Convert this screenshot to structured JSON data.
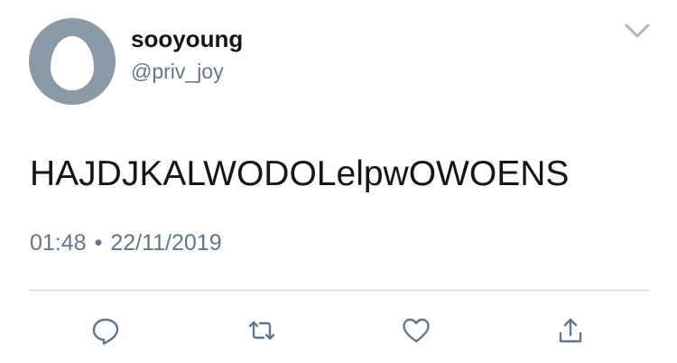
{
  "user": {
    "display_name": "sooyoung",
    "handle": "@priv_joy",
    "avatar_icon": "default-egg-avatar"
  },
  "tweet": {
    "text": "HAJDJKALWODOLelpwOWOENS",
    "time": "01:48",
    "separator": "•",
    "date": "22/11/2019"
  },
  "menu": {
    "icon": "chevron-down-icon"
  },
  "actions": {
    "reply_icon": "reply-icon",
    "retweet_icon": "retweet-icon",
    "like_icon": "heart-icon",
    "share_icon": "share-icon"
  },
  "colors": {
    "text": "#14171a",
    "secondary_text": "#657786",
    "icon": "#657786",
    "divider": "#ccd6dd",
    "avatar_bg": "#8b9aa6"
  }
}
